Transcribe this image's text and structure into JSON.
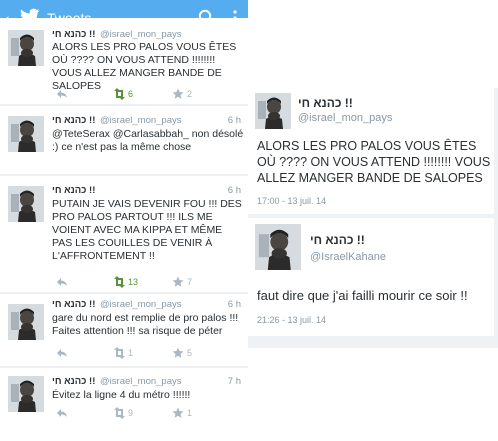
{
  "app": {
    "title": "Tweets",
    "back_icon": "chevron-left-icon",
    "bird_icon": "twitter-bird-icon",
    "search_icon": "search-icon",
    "overflow_icon": "overflow-menu-icon",
    "accent": "#55acee"
  },
  "timeline": [
    {
      "name": "כהנא חי !!",
      "handle": "@israel_mon_pays",
      "time": "",
      "text": "ALORS LES PRO PALOS VOUS ÊTES OÙ ???? ON VOUS ATTEND !!!!!!!! VOUS ALLEZ MANGER BANDE DE SALOPES",
      "retweets": "6",
      "favorites": "2",
      "retweeted": true
    },
    {
      "name": "כהנא חי !!",
      "handle": "@israel_mon_pays",
      "time": "6 h",
      "text": "@TeteSerax @Carlasabbah_ non désolé :) ce n'est pas la même chose",
      "retweets": "",
      "favorites": "",
      "retweeted": false
    },
    {
      "name": "כהנא חי !!",
      "handle": "@israel_mon_pays",
      "time": "6 h",
      "text": "PUTAIN JE VAIS DEVENIR FOU !!! DES PRO PALOS PARTOUT !!! ILS ME VOIENT AVEC MA KIPPA ET MÊME PAS LES COUILLES DE VENIR À L'AFFRONTEMENT !!",
      "retweets": "13",
      "favorites": "7",
      "retweeted": true
    },
    {
      "name": "כהנא חי !!",
      "handle": "@israel_mon_pays",
      "time": "6 h",
      "text": "gare du nord est remplie de pro palos !!! Faites attention !!! sa risque de péter",
      "retweets": "1",
      "favorites": "5",
      "retweeted": false
    },
    {
      "name": "כהנא חי !!",
      "handle": "@israel_mon_pays",
      "time": "7 h",
      "text": "Évitez la ligne 4 du métro !!!!!!",
      "retweets": "9",
      "favorites": "1",
      "retweeted": false
    }
  ],
  "web_tweets": [
    {
      "name": "כהנא חי !!",
      "handle": "@israel_mon_pays",
      "text": "ALORS LES PRO PALOS VOUS ÊTES OÙ ???? ON VOUS ATTEND !!!!!!!! VOUS ALLEZ MANGER BANDE DE SALOPES",
      "stamp": "17:00 - 13 juil. 14"
    },
    {
      "name": "כהנא חי !!",
      "handle": "@IsraelKahane",
      "text": "faut dire que j'ai failli mourir ce soir !!",
      "stamp": "21:26 - 13 juil. 14"
    }
  ],
  "icons": {
    "retweet": "retweet-icon",
    "favorite": "star-icon",
    "reply": "reply-icon",
    "avatar": "avatar"
  },
  "colors": {
    "retweet_active": "#5c913b",
    "icon_idle": "#aab8c2",
    "handle": "#8899a6",
    "text": "#292f33"
  }
}
